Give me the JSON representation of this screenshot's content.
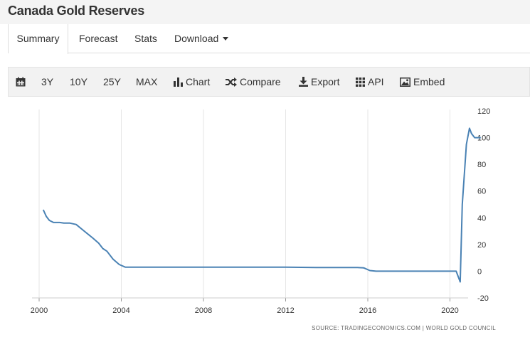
{
  "page": {
    "title": "Canada Gold Reserves"
  },
  "tabs": [
    {
      "label": "Summary",
      "active": true
    },
    {
      "label": "Forecast"
    },
    {
      "label": "Stats"
    },
    {
      "label": "Download"
    }
  ],
  "toolbar": {
    "range_3y": "3Y",
    "range_10y": "10Y",
    "range_25y": "25Y",
    "range_max": "MAX",
    "chart_label": "Chart",
    "compare_label": "Compare",
    "export_label": "Export",
    "api_label": "API",
    "embed_label": "Embed"
  },
  "colors": {
    "line": "#4a82b4",
    "grid": "#e6e6e6",
    "axis_text": "#333333"
  },
  "chart_data": {
    "type": "line",
    "title": "",
    "xlabel": "",
    "ylabel": "",
    "xlim": [
      2000,
      2021.6
    ],
    "ylim": [
      -20,
      120
    ],
    "x_ticks": [
      2000,
      2004,
      2008,
      2012,
      2016,
      2020
    ],
    "y_ticks": [
      -20,
      0,
      20,
      40,
      60,
      80,
      100,
      120
    ],
    "grid": "vertical",
    "y_axis_side": "right",
    "source": "SOURCE: TRADINGECONOMICS.COM  |  WORLD GOLD COUNCIL",
    "series": [
      {
        "x": [
          2000.2,
          2000.35,
          2000.5,
          2000.7,
          2001.0,
          2001.2,
          2001.5,
          2001.8,
          2002.2,
          2002.6,
          2002.9,
          2003.1,
          2003.3,
          2003.6,
          2003.9,
          2004.2,
          2008.0,
          2012.0,
          2013.5,
          2015.5,
          2015.8,
          2016.1,
          2016.4,
          2018.0,
          2020.0,
          2020.3,
          2020.5,
          2020.6,
          2020.8,
          2020.95,
          2021.05,
          2021.2,
          2021.5
        ],
        "y": [
          46,
          41,
          38,
          36.5,
          36.5,
          36,
          36,
          35,
          30,
          25,
          21,
          17,
          15,
          9,
          5,
          3,
          3,
          3,
          2.8,
          2.8,
          2.5,
          0.5,
          0,
          0,
          0,
          0,
          -8,
          50,
          95,
          107,
          103,
          100,
          100
        ]
      }
    ]
  }
}
